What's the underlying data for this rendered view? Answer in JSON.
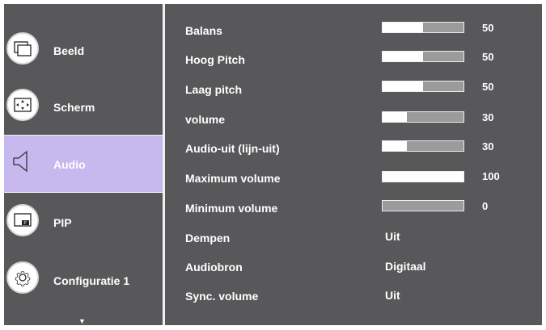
{
  "sidebar": {
    "items": [
      {
        "label": "Beeld",
        "icon": "picture-icon"
      },
      {
        "label": "Scherm",
        "icon": "screen-icon"
      },
      {
        "label": "Audio",
        "icon": "speaker-icon",
        "active": true
      },
      {
        "label": "PIP",
        "icon": "pip-icon"
      },
      {
        "label": "Configuratie 1",
        "icon": "gear-icon"
      }
    ],
    "more_indicator": "▼",
    "active_color": "#c7b8ee"
  },
  "settings": [
    {
      "label": "Balans",
      "type": "slider",
      "value": 50,
      "value_text": "50"
    },
    {
      "label": "Hoog Pitch",
      "type": "slider",
      "value": 50,
      "value_text": "50"
    },
    {
      "label": "Laag pitch",
      "type": "slider",
      "value": 50,
      "value_text": "50"
    },
    {
      "label": "volume",
      "type": "slider",
      "value": 30,
      "value_text": "30"
    },
    {
      "label": "Audio-uit (lijn-uit)",
      "type": "slider",
      "value": 30,
      "value_text": "30"
    },
    {
      "label": "Maximum volume",
      "type": "slider",
      "value": 100,
      "value_text": "100"
    },
    {
      "label": "Minimum volume",
      "type": "slider",
      "value": 0,
      "value_text": "0"
    },
    {
      "label": "Dempen",
      "type": "option",
      "value_text": "Uit"
    },
    {
      "label": "Audiobron",
      "type": "option",
      "value_text": "Digitaal"
    },
    {
      "label": "Sync. volume",
      "type": "option",
      "value_text": "Uit"
    }
  ]
}
